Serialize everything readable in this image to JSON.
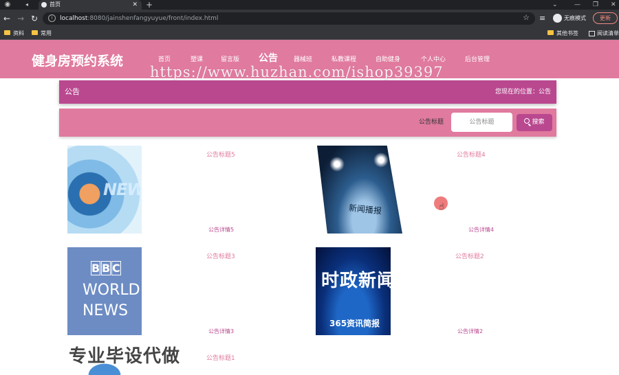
{
  "browser": {
    "tab_title": "首页",
    "url_host": "localhost",
    "url_rest": ":8080/jainshenfangyuyue/front/index.html",
    "incognito_label": "无痕模式",
    "update_label": "更新"
  },
  "bookmarks": [
    {
      "label": "资料"
    },
    {
      "label": "常用"
    },
    {
      "label": "其他书签"
    },
    {
      "label": "阅读清单"
    }
  ],
  "header": {
    "site_title": "健身房预约系统",
    "nav": [
      {
        "label": "首页"
      },
      {
        "label": "塑课"
      },
      {
        "label": "留言版"
      },
      {
        "label": "公告"
      },
      {
        "label": "器械班"
      },
      {
        "label": "私教课程"
      },
      {
        "label": "自助健身"
      },
      {
        "label": "个人中心"
      },
      {
        "label": "后台管理"
      }
    ]
  },
  "watermark": "https://www.huzhan.com/ishop39397",
  "breadcrumb": {
    "title": "公告",
    "location": "您现在的位置：公告"
  },
  "search": {
    "label": "公告标题",
    "placeholder": "公告标题",
    "button_label": "搜索"
  },
  "cards": [
    {
      "title": "公告标题5",
      "detail": "公告详情5",
      "image_text": "NEWS"
    },
    {
      "title": "公告标题4",
      "detail": "公告详情4",
      "image_text": "新闻播报"
    },
    {
      "title": "公告标题3",
      "detail": "公告详情3",
      "image_text_1": "BBC",
      "image_text_2": "WORLD NEWS"
    },
    {
      "title": "公告标题2",
      "detail": "公告详情2",
      "image_text_1": "时政新闻",
      "image_text_2": "365资讯简报"
    },
    {
      "title": "公告标题1"
    }
  ],
  "promo": "专业毕设代做",
  "colors": {
    "header_pink": "#e07a9e",
    "breadcrumb_purple": "#b9488f"
  }
}
